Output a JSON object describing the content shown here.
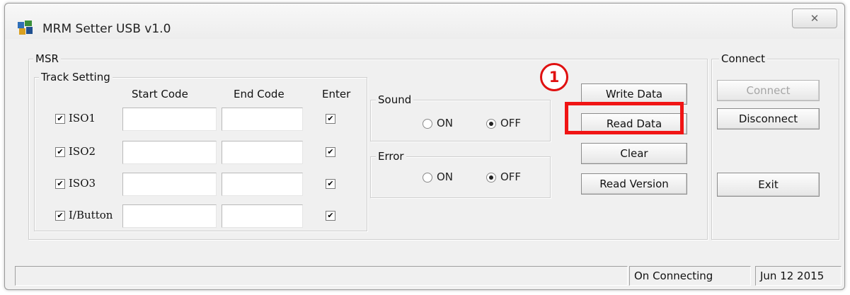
{
  "window": {
    "title": "MRM Setter USB v1.0",
    "close_glyph": "✕"
  },
  "msr": {
    "label": "MSR",
    "track_setting": {
      "label": "Track Setting",
      "headers": {
        "start": "Start Code",
        "end": "End Code",
        "enter": "Enter"
      },
      "rows": [
        {
          "label": "ISO1",
          "checked": true,
          "start": "",
          "end": "",
          "enter": true
        },
        {
          "label": "ISO2",
          "checked": true,
          "start": "",
          "end": "",
          "enter": true
        },
        {
          "label": "ISO3",
          "checked": true,
          "start": "",
          "end": "",
          "enter": true
        },
        {
          "label": "I/Button",
          "checked": true,
          "start": "",
          "end": "",
          "enter": true
        }
      ]
    },
    "sound": {
      "label": "Sound",
      "on": "ON",
      "off": "OFF",
      "selected": "OFF"
    },
    "error": {
      "label": "Error",
      "on": "ON",
      "off": "OFF",
      "selected": "OFF"
    },
    "buttons": {
      "write": "Write Data",
      "read": "Read Data",
      "clear": "Clear",
      "read_version": "Read Version"
    },
    "annotation": {
      "step": "1",
      "color": "#f01414"
    }
  },
  "connect": {
    "label": "Connect",
    "connect_btn": "Connect",
    "connect_enabled": false,
    "disconnect_btn": "Disconnect",
    "exit_btn": "Exit"
  },
  "status": {
    "message": "",
    "connection": "On Connecting",
    "date": "Jun 12 2015"
  },
  "icons": {
    "app": "app-logo-icon",
    "check": "✔"
  }
}
